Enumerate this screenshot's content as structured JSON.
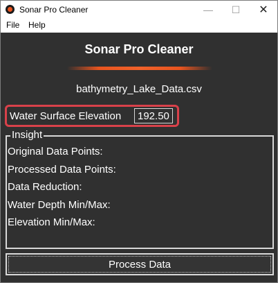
{
  "window": {
    "title": "Sonar Pro Cleaner",
    "controls": {
      "minimize": "—",
      "maximize": "☐",
      "close": "✕"
    }
  },
  "menu": {
    "file": "File",
    "help": "Help"
  },
  "header": {
    "title": "Sonar Pro Cleaner",
    "accent_color": "#e8541f"
  },
  "file": {
    "name": "bathymetry_Lake_Data.csv"
  },
  "elevation": {
    "label": "Water Surface Elevation",
    "value": "192.50",
    "highlight_color": "#d9414a"
  },
  "insight": {
    "title": "Insight",
    "rows": [
      "Original Data Points:",
      "Processed Data Points:",
      "Data Reduction:",
      "Water Depth Min/Max:",
      "Elevation Min/Max:"
    ]
  },
  "actions": {
    "process": "Process Data"
  },
  "colors": {
    "background": "#303030",
    "text": "#ffffff",
    "border": "#d8d8d8"
  },
  "icons": {
    "app": "sonar-app-icon"
  }
}
